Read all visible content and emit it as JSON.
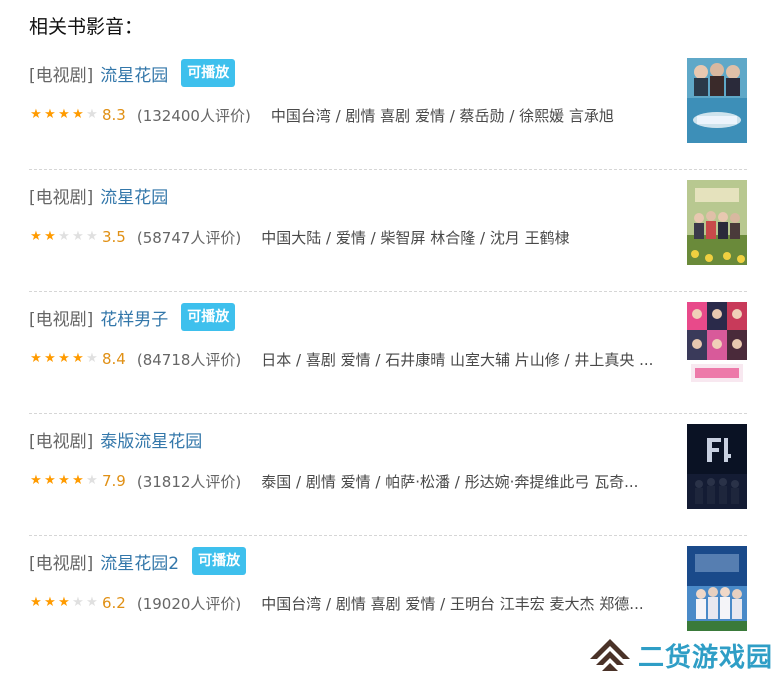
{
  "section_title": "相关书影音：",
  "items": [
    {
      "category": "[电视剧]",
      "title": "流星花园",
      "badge": "可播放",
      "stars_full": 4,
      "rating": "8.3",
      "votes": "(132400人评价)",
      "info": "中国台湾 / 剧情 喜剧 爱情 / 蔡岳勋 / 徐熙媛 言承旭",
      "poster_icon": "poster-meteor-garden-2001"
    },
    {
      "category": "[电视剧]",
      "title": "流星花园",
      "badge": "",
      "stars_full": 2,
      "rating": "3.5",
      "votes": "(58747人评价)",
      "info": "中国大陆 / 爱情 / 柴智屏 林合隆 / 沈月 王鹤棣",
      "poster_icon": "poster-meteor-garden-2018"
    },
    {
      "category": "[电视剧]",
      "title": "花样男子",
      "badge": "可播放",
      "stars_full": 4,
      "rating": "8.4",
      "votes": "(84718人评价)",
      "info": "日本 / 喜剧 爱情 / 石井康晴 山室大辅 片山修 / 井上真央 ...",
      "poster_icon": "poster-hana-yori-dango"
    },
    {
      "category": "[电视剧]",
      "title": "泰版流星花园",
      "badge": "",
      "stars_full": 4,
      "rating": "7.9",
      "votes": "(31812人评价)",
      "info": "泰国 / 剧情 爱情 / 帕萨·松潘 / 彤达婉·奔提维此弓 瓦奇...",
      "poster_icon": "poster-f4-thailand"
    },
    {
      "category": "[电视剧]",
      "title": "流星花园2",
      "badge": "可播放",
      "stars_full": 3,
      "rating": "6.2",
      "votes": "(19020人评价)",
      "info": "中国台湾 / 剧情 喜剧 爱情 / 王明台 江丰宏 麦大杰 郑德...",
      "poster_icon": "poster-meteor-garden-2"
    }
  ],
  "watermark": {
    "text": "二货游戏园"
  },
  "colors": {
    "link": "#3377aa",
    "badge": "#3ec0ed",
    "star": "#ff9b00",
    "rating": "#e09015",
    "watermark": "#2f9ec6"
  }
}
